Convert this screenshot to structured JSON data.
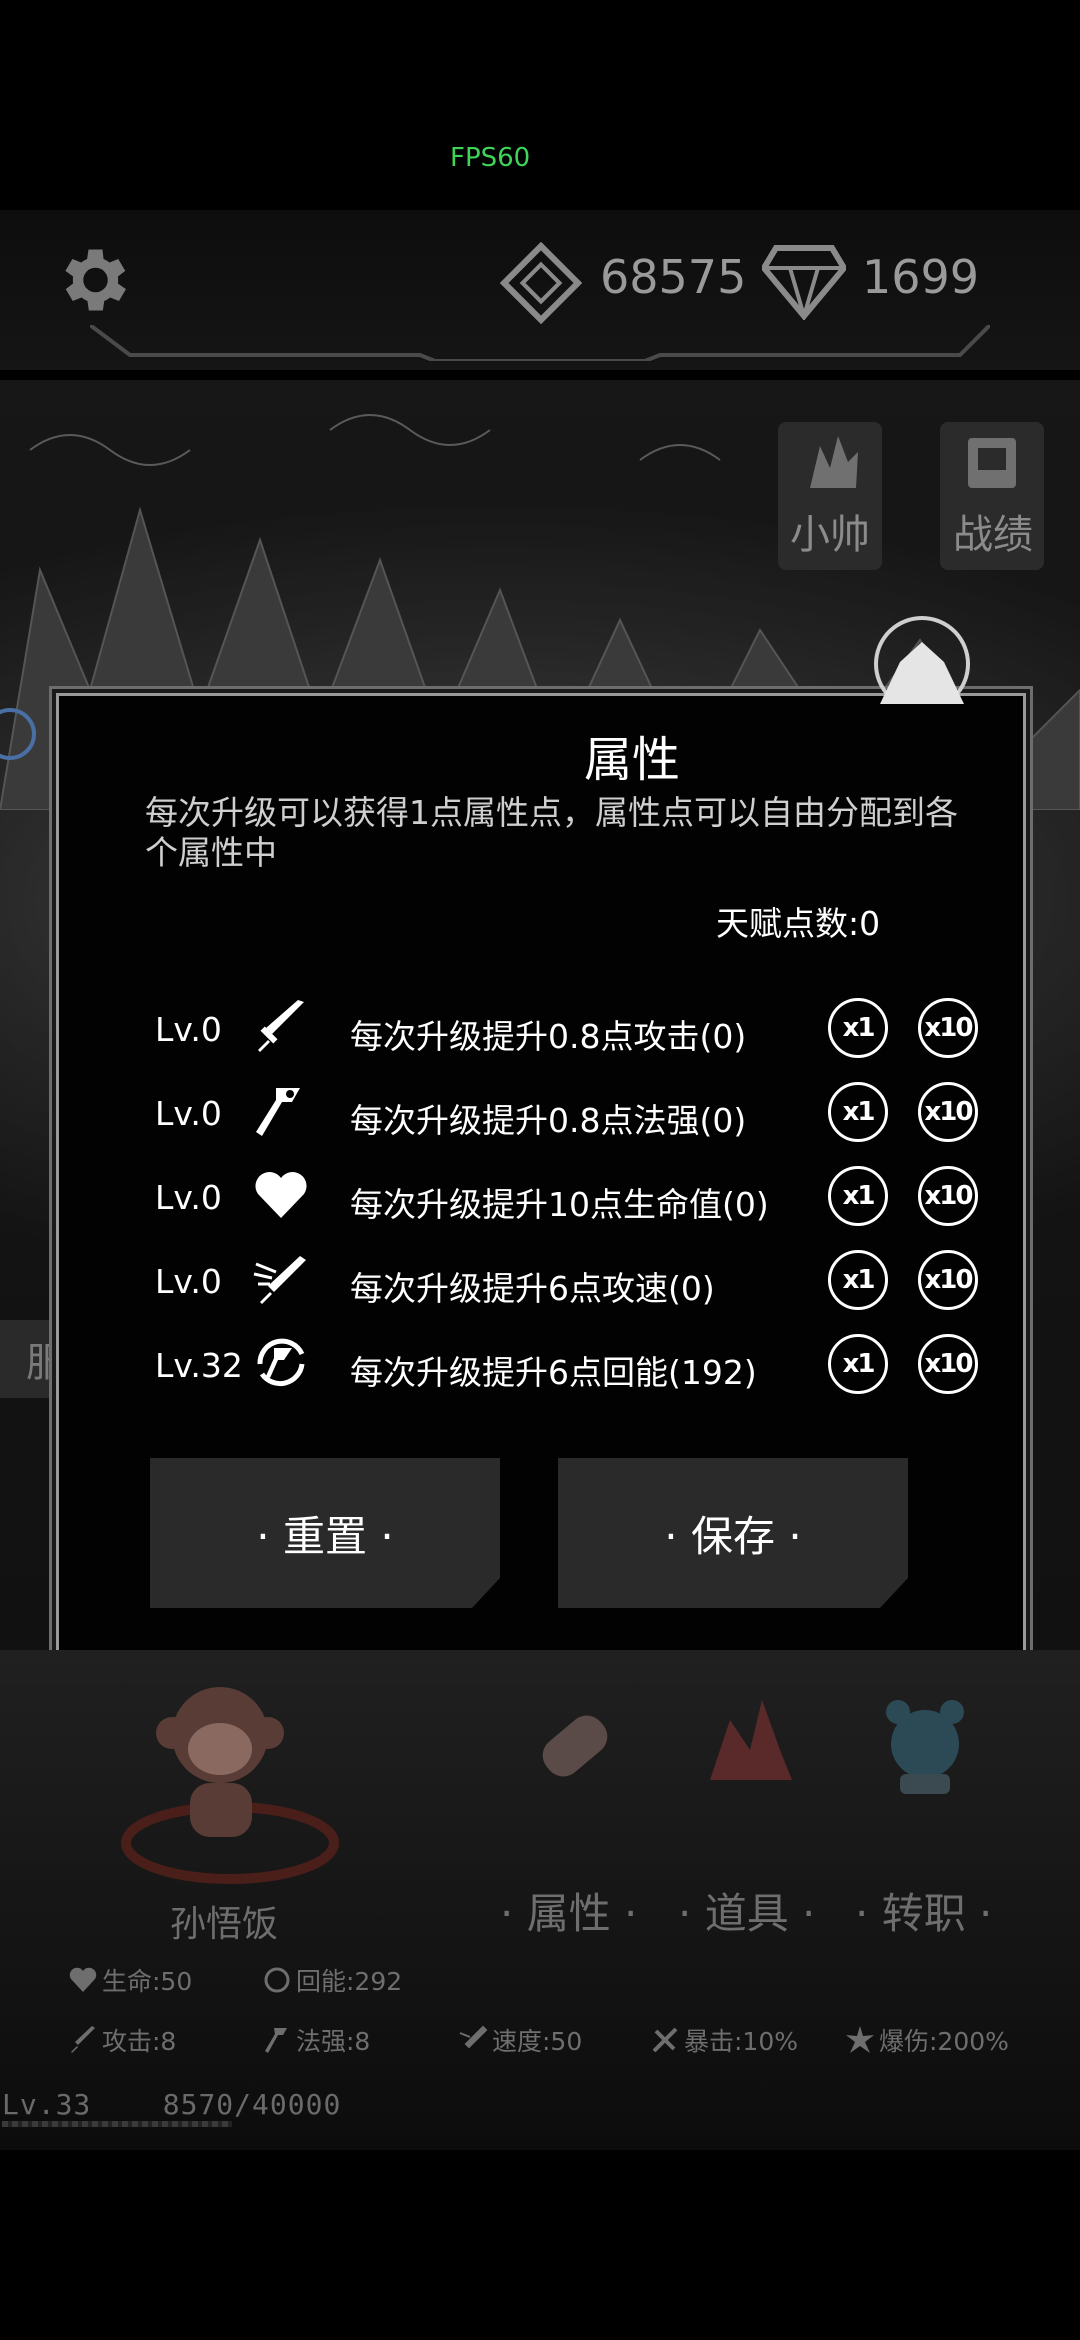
{
  "hud": {
    "fps": "FPS60",
    "coins": "68575",
    "diamonds": "1699"
  },
  "side_buttons": [
    {
      "label": "小帅",
      "icon": "crystal-icon"
    },
    {
      "label": "战绩",
      "icon": "book-icon"
    }
  ],
  "side_stub_label": "服",
  "modal": {
    "title": "属性",
    "description": "每次升级可以获得1点属性点，属性点可以自由分配到各个属性中",
    "talent_points": "天赋点数:0",
    "rows": [
      {
        "level": "Lv.0",
        "icon": "sword-icon",
        "text": "每次升级提升0.8点攻击(0)",
        "x1": "x1",
        "x10": "x10"
      },
      {
        "level": "Lv.0",
        "icon": "magic-staff-icon",
        "text": "每次升级提升0.8点法强(0)",
        "x1": "x1",
        "x10": "x10"
      },
      {
        "level": "Lv.0",
        "icon": "heart-icon",
        "text": "每次升级提升10点生命值(0)",
        "x1": "x1",
        "x10": "x10"
      },
      {
        "level": "Lv.0",
        "icon": "attack-speed-icon",
        "text": "每次升级提升6点攻速(0)",
        "x1": "x1",
        "x10": "x10"
      },
      {
        "level": "Lv.32",
        "icon": "energy-regen-icon",
        "text": "每次升级提升6点回能(192)",
        "x1": "x1",
        "x10": "x10"
      }
    ],
    "reset_label": "· 重置 ·",
    "save_label": "· 保存 ·"
  },
  "character": {
    "name": "孙悟饭",
    "level": "Lv.33",
    "exp": "8570/40000",
    "exp_fraction": 0.214
  },
  "tabs": [
    {
      "label": "· 属性 ·",
      "icon": "scroll-icon"
    },
    {
      "label": "· 道具 ·",
      "icon": "red-crystal-icon"
    },
    {
      "label": "· 转职 ·",
      "icon": "blue-bear-icon"
    }
  ],
  "stats": {
    "hp": "生命:50",
    "regen": "回能:292",
    "attack": "攻击:8",
    "magic": "法强:8",
    "speed": "速度:50",
    "crit": "暴击:10%",
    "crit_dmg": "爆伤:200%"
  },
  "colors": {
    "fps": "#3fd35a",
    "modal_border": "#9a9a9a",
    "button_bg": "#2a2a2a"
  }
}
